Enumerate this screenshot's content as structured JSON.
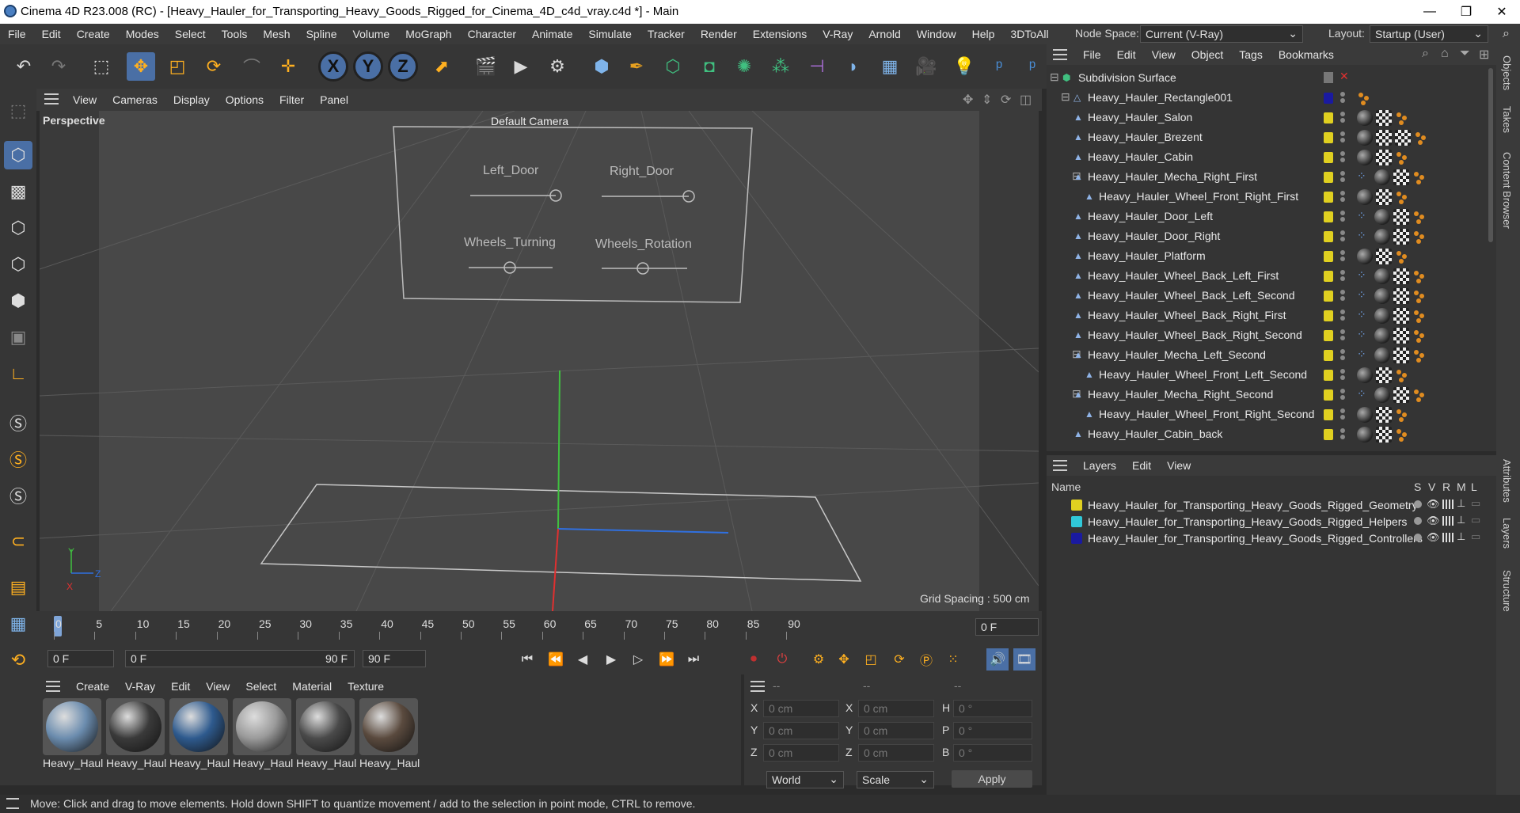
{
  "window": {
    "title": "Cinema 4D R23.008 (RC) - [Heavy_Hauler_for_Transporting_Heavy_Goods_Rigged_for_Cinema_4D_c4d_vray.c4d *] - Main",
    "minimize": "—",
    "maximize": "❐",
    "close": "✕"
  },
  "menubar": {
    "items": [
      "File",
      "Edit",
      "Create",
      "Modes",
      "Select",
      "Tools",
      "Mesh",
      "Spline",
      "Volume",
      "MoGraph",
      "Character",
      "Animate",
      "Simulate",
      "Tracker",
      "Render",
      "Extensions",
      "V-Ray",
      "Arnold",
      "Window",
      "Help",
      "3DToAll"
    ],
    "node_space_label": "Node Space:",
    "node_space_value": "Current (V-Ray)",
    "layout_label": "Layout:",
    "layout_value": "Startup (User)"
  },
  "toolbar": {
    "axis_x": "X",
    "axis_y": "Y",
    "axis_z": "Z"
  },
  "viewport": {
    "menu": [
      "View",
      "Cameras",
      "Display",
      "Options",
      "Filter",
      "Panel"
    ],
    "label": "Perspective",
    "camera": "Default Camera",
    "grid_spacing": "Grid Spacing : 500 cm",
    "controls": {
      "left_door": "Left_Door",
      "right_door": "Right_Door",
      "wheels_turning": "Wheels_Turning",
      "wheels_rotation": "Wheels_Rotation"
    },
    "axis_y": "Y",
    "axis_z": "Z",
    "axis_x": "X"
  },
  "timeline": {
    "ticks": [
      "0",
      "5",
      "10",
      "15",
      "20",
      "25",
      "30",
      "35",
      "40",
      "45",
      "50",
      "55",
      "60",
      "65",
      "70",
      "75",
      "80",
      "85",
      "90"
    ],
    "current_frame_field": "0 F"
  },
  "transport": {
    "start_field": "0 F",
    "range_start": "0 F",
    "range_end": "90 F",
    "end_field": "90 F"
  },
  "material_manager": {
    "menu": [
      "Create",
      "V-Ray",
      "Edit",
      "View",
      "Select",
      "Material",
      "Texture"
    ],
    "materials": [
      {
        "label": "Heavy_Haul",
        "color": "#6b8cae"
      },
      {
        "label": "Heavy_Haul",
        "color": "#3a3a3a"
      },
      {
        "label": "Heavy_Haul",
        "color": "#2e5a8e"
      },
      {
        "label": "Heavy_Haul",
        "color": "#9a9a9a"
      },
      {
        "label": "Heavy_Haul",
        "color": "#4a4a4a"
      },
      {
        "label": "Heavy_Haul",
        "color": "#5a4a3e"
      }
    ]
  },
  "coordinates": {
    "col1": "--",
    "col2": "--",
    "col3": "--",
    "rows": [
      {
        "a": "X",
        "av": "0 cm",
        "b": "X",
        "bv": "0 cm",
        "c": "H",
        "cv": "0 °"
      },
      {
        "a": "Y",
        "av": "0 cm",
        "b": "Y",
        "bv": "0 cm",
        "c": "P",
        "cv": "0 °"
      },
      {
        "a": "Z",
        "av": "0 cm",
        "b": "Z",
        "bv": "0 cm",
        "c": "B",
        "cv": "0 °"
      }
    ],
    "world": "World",
    "scale": "Scale",
    "apply": "Apply"
  },
  "object_manager": {
    "menu": [
      "File",
      "Edit",
      "View",
      "Object",
      "Tags",
      "Bookmarks"
    ],
    "root": "Subdivision Surface",
    "rect": "Heavy_Hauler_Rectangle001",
    "objects": [
      {
        "name": "Heavy_Hauler_Salon",
        "indent": 0
      },
      {
        "name": "Heavy_Hauler_Brezent",
        "indent": 0
      },
      {
        "name": "Heavy_Hauler_Cabin",
        "indent": 0
      },
      {
        "name": "Heavy_Hauler_Mecha_Right_First",
        "indent": 0
      },
      {
        "name": "Heavy_Hauler_Wheel_Front_Right_First",
        "indent": 1
      },
      {
        "name": "Heavy_Hauler_Door_Left",
        "indent": 0
      },
      {
        "name": "Heavy_Hauler_Door_Right",
        "indent": 0
      },
      {
        "name": "Heavy_Hauler_Platform",
        "indent": 0
      },
      {
        "name": "Heavy_Hauler_Wheel_Back_Left_First",
        "indent": 0
      },
      {
        "name": "Heavy_Hauler_Wheel_Back_Left_Second",
        "indent": 0
      },
      {
        "name": "Heavy_Hauler_Wheel_Back_Right_First",
        "indent": 0
      },
      {
        "name": "Heavy_Hauler_Wheel_Back_Right_Second",
        "indent": 0
      },
      {
        "name": "Heavy_Hauler_Mecha_Left_Second",
        "indent": 0
      },
      {
        "name": "Heavy_Hauler_Wheel_Front_Left_Second",
        "indent": 1
      },
      {
        "name": "Heavy_Hauler_Mecha_Right_Second",
        "indent": 0
      },
      {
        "name": "Heavy_Hauler_Wheel_Front_Right_Second",
        "indent": 1
      },
      {
        "name": "Heavy_Hauler_Cabin_back",
        "indent": 0
      }
    ]
  },
  "layers": {
    "menu": [
      "Layers",
      "Edit",
      "View"
    ],
    "header_name": "Name",
    "header_cols": [
      "S",
      "V",
      "R",
      "M",
      "L"
    ],
    "items": [
      {
        "name": "Heavy_Hauler_for_Transporting_Heavy_Goods_Rigged_Geometry",
        "color": "#e0d020"
      },
      {
        "name": "Heavy_Hauler_for_Transporting_Heavy_Goods_Rigged_Helpers",
        "color": "#30c8d8"
      },
      {
        "name": "Heavy_Hauler_for_Transporting_Heavy_Goods_Rigged_Controllers",
        "color": "#1a1aa0"
      }
    ]
  },
  "right_tabs": [
    "Objects",
    "Takes",
    "Content Browser",
    "Attributes",
    "Layers",
    "Structure"
  ],
  "status": "Move: Click and drag to move elements. Hold down SHIFT to quantize movement / add to the selection in point mode, CTRL to remove."
}
